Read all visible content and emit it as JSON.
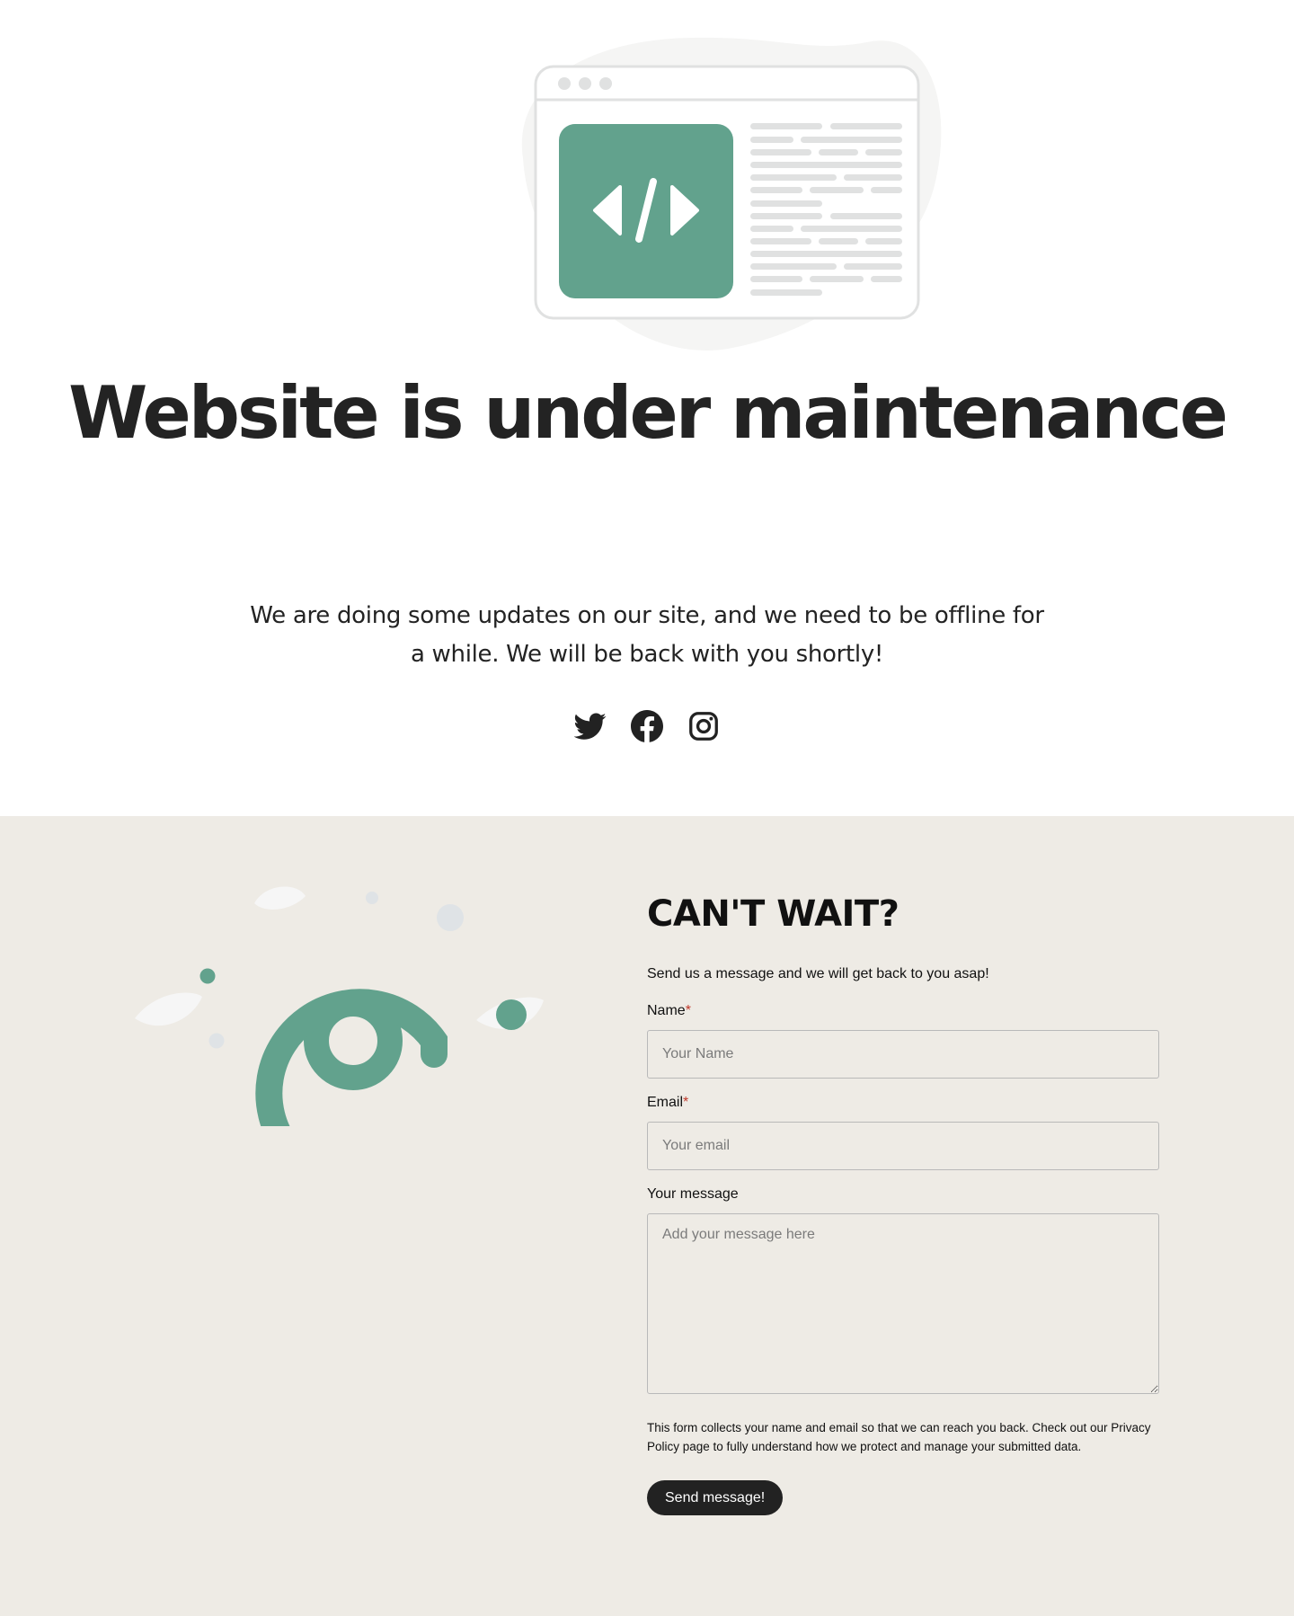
{
  "hero": {
    "illustration_icon": "code-window-illustration",
    "title": "Website is under maintenance",
    "text": "We are doing some updates on our site, and we need to be offline for a while. We will be back with you shortly!"
  },
  "social": [
    {
      "icon": "twitter-icon"
    },
    {
      "icon": "facebook-icon"
    },
    {
      "icon": "instagram-icon"
    }
  ],
  "contact": {
    "illustration_icon": "at-sign-illustration",
    "title": "CAN'T WAIT?",
    "intro": "Send us a message and we will get back to you asap!",
    "fields": {
      "name": {
        "label": "Name",
        "required_mark": "*",
        "placeholder": "Your Name",
        "value": ""
      },
      "email": {
        "label": "Email",
        "required_mark": "*",
        "placeholder": "Your email",
        "value": ""
      },
      "message": {
        "label": "Your message",
        "placeholder": "Add your message here",
        "value": ""
      }
    },
    "notice": "This form collects your name and email so that we can reach you back. Check out our Privacy Policy page to fully understand how we protect and manage your submitted data.",
    "submit_label": "Send message!"
  },
  "colors": {
    "accent": "#62a28d",
    "text_dark": "#232323",
    "section_bg": "#eeebe5",
    "button_bg": "#222222",
    "required": "#c0392b"
  }
}
